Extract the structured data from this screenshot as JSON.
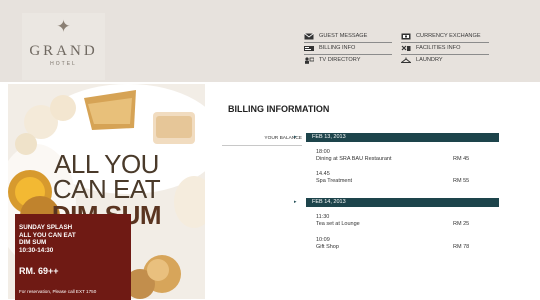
{
  "logo": {
    "star": "✦",
    "name": "GRAND",
    "sub": "HOTEL"
  },
  "nav": [
    {
      "label": "GUEST MESSAGE",
      "icon": "envelope-icon"
    },
    {
      "label": "CURRENCY EXCHANGE",
      "icon": "currency-icon"
    },
    {
      "label": "BILLING INFO",
      "icon": "billing-icon"
    },
    {
      "label": "FACILITIES INFO",
      "icon": "facilities-icon"
    },
    {
      "label": "TV DIRECTORY",
      "icon": "tv-directory-icon"
    },
    {
      "label": "LAUNDRY",
      "icon": "laundry-icon"
    }
  ],
  "promo": {
    "title_line1": "ALL YOU",
    "title_line2": "CAN EAT",
    "title_line3": "DIM SUM",
    "box_line1": "SUNDAY SPLASH",
    "box_line2": "ALL YOU CAN EAT",
    "box_line3": "DIM SUM",
    "box_line4": "10:30-14:30",
    "price": "RM. 69++",
    "reservation": "For reservation, Please call EXT 1750"
  },
  "billing": {
    "title": "BILLING INFORMATION",
    "balance_label": "YOUR BALANCE",
    "days": [
      {
        "date": "FEB 13, 2013",
        "items": [
          {
            "time": "18:00",
            "desc": "Dining at SRA BAU Restaurant",
            "amount": "RM 45"
          },
          {
            "time": "14.45",
            "desc": "Spa Treatment",
            "amount": "RM 55"
          }
        ]
      },
      {
        "date": "FEB 14, 2013",
        "items": [
          {
            "time": "11:30",
            "desc": "Tea set at Lounge",
            "amount": "RM 25"
          },
          {
            "time": "10:09",
            "desc": "Gift Shop",
            "amount": "RM 78"
          }
        ]
      }
    ]
  },
  "colors": {
    "header_bg": "#e7e2dd",
    "accent_teal": "#1d444b",
    "promo_red": "#6f1a14"
  }
}
